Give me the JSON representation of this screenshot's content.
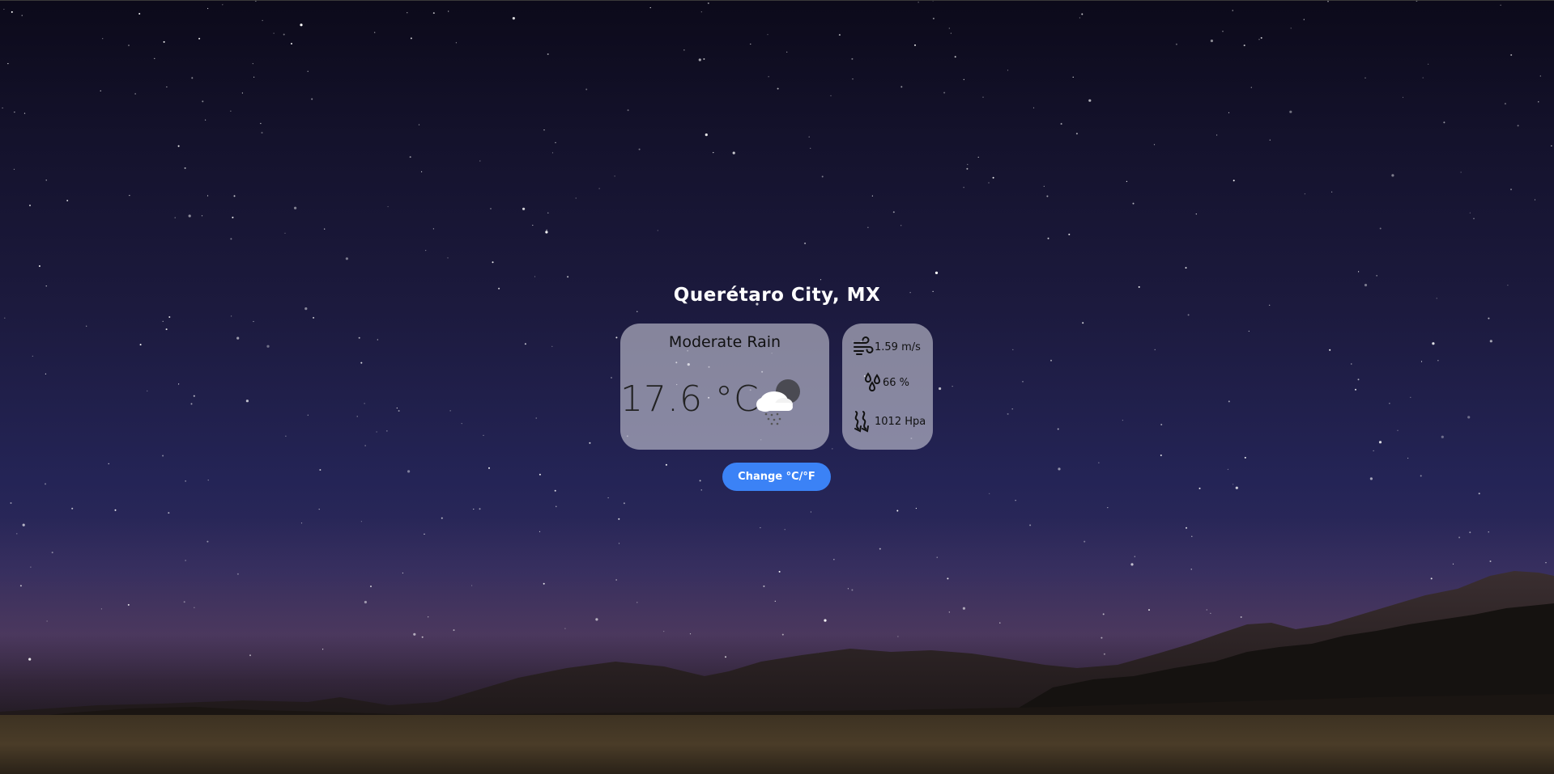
{
  "location": {
    "city": "Querétaro City, MX"
  },
  "current": {
    "condition": "Moderate Rain",
    "temperature": "17.6 °C",
    "icon": "cloud-moon-rain-icon"
  },
  "stats": {
    "wind": {
      "value": "1.59 m/s",
      "icon": "wind-icon"
    },
    "humidity": {
      "value": "66 %",
      "icon": "water-drops-icon"
    },
    "pressure": {
      "value": "1012 Hpa",
      "icon": "pressure-icon"
    }
  },
  "actions": {
    "toggle_units_label": "Change °C/°F"
  },
  "colors": {
    "accent": "#3b82f6",
    "card_bg": "rgba(210,210,222,0.58)",
    "title": "#ffffff"
  }
}
